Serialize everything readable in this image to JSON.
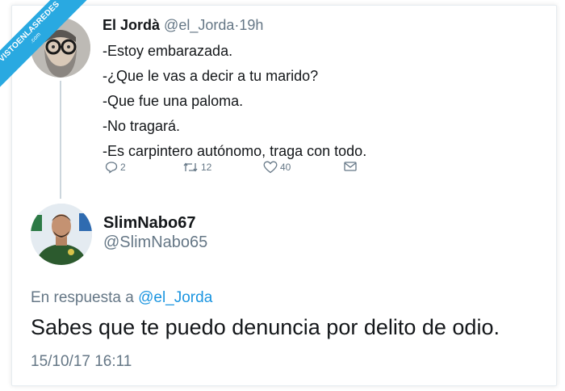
{
  "watermark": {
    "line1": "VISTOENLASREDES",
    "line2": ".com"
  },
  "tweet1": {
    "name": "El Jordà",
    "handle": "@el_Jorda",
    "separator": "·",
    "time": "19h",
    "lines": [
      "-Estoy embarazada.",
      "-¿Que le vas a decir a tu marido?",
      "-Que fue una paloma.",
      "-No tragará.",
      "-Es carpintero autónomo, traga con todo."
    ],
    "actions": {
      "replies": "2",
      "retweets": "12",
      "likes": "40"
    }
  },
  "reply": {
    "name": "SlimNabo67",
    "handle": "@SlimNabo65",
    "reply_prefix": "En respuesta a",
    "reply_to": "@el_Jorda",
    "text": "Sabes que te puedo denuncia por delito de odio.",
    "timestamp": "15/10/17 16:11"
  },
  "colors": {
    "link": "#1b95e0",
    "muted": "#657786",
    "watermark": "#29a9e1"
  },
  "icons": [
    "reply-icon",
    "retweet-icon",
    "like-icon",
    "message-icon"
  ]
}
